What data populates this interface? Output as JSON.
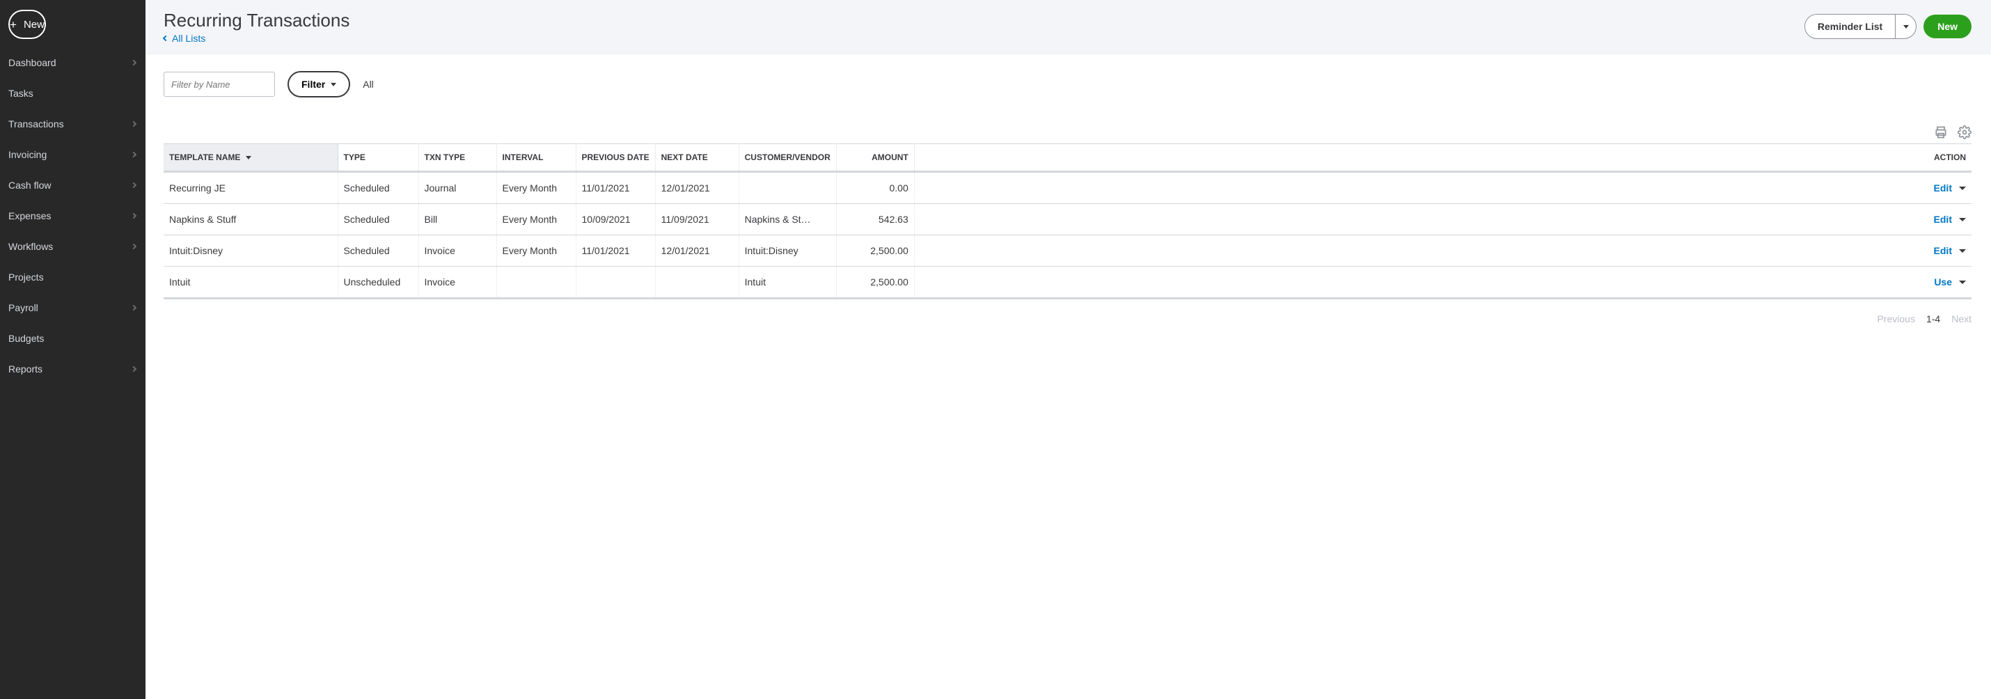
{
  "sidebar": {
    "new_label": "New",
    "items": [
      {
        "label": "Dashboard",
        "chevron": true
      },
      {
        "label": "Tasks",
        "chevron": false
      },
      {
        "label": "Transactions",
        "chevron": true
      },
      {
        "label": "Invoicing",
        "chevron": true
      },
      {
        "label": "Cash flow",
        "chevron": true
      },
      {
        "label": "Expenses",
        "chevron": true
      },
      {
        "label": "Workflows",
        "chevron": true
      },
      {
        "label": "Projects",
        "chevron": false
      },
      {
        "label": "Payroll",
        "chevron": true
      },
      {
        "label": "Budgets",
        "chevron": false
      },
      {
        "label": "Reports",
        "chevron": true
      }
    ]
  },
  "header": {
    "title": "Recurring Transactions",
    "back_link": "All Lists",
    "reminder_button": "Reminder List",
    "new_button": "New"
  },
  "toolbar": {
    "name_filter_placeholder": "Filter by Name",
    "filter_button": "Filter",
    "scope_label": "All"
  },
  "table": {
    "columns": {
      "name": "TEMPLATE NAME",
      "type": "TYPE",
      "txn": "TXN TYPE",
      "interval": "INTERVAL",
      "prev": "PREVIOUS DATE",
      "next": "NEXT DATE",
      "cust": "CUSTOMER/VENDOR",
      "amount": "AMOUNT",
      "action": "ACTION"
    },
    "rows": [
      {
        "name": "Recurring JE",
        "type": "Scheduled",
        "txn": "Journal",
        "interval": "Every Month",
        "prev": "11/01/2021",
        "next": "12/01/2021",
        "cust": "",
        "amount": "0.00",
        "action": "Edit"
      },
      {
        "name": "Napkins & Stuff",
        "type": "Scheduled",
        "txn": "Bill",
        "interval": "Every Month",
        "prev": "10/09/2021",
        "next": "11/09/2021",
        "cust": "Napkins & St…",
        "amount": "542.63",
        "action": "Edit"
      },
      {
        "name": "Intuit:Disney",
        "type": "Scheduled",
        "txn": "Invoice",
        "interval": "Every Month",
        "prev": "11/01/2021",
        "next": "12/01/2021",
        "cust": "Intuit:Disney",
        "amount": "2,500.00",
        "action": "Edit"
      },
      {
        "name": "Intuit",
        "type": "Unscheduled",
        "txn": "Invoice",
        "interval": "",
        "prev": "",
        "next": "",
        "cust": "Intuit",
        "amount": "2,500.00",
        "action": "Use"
      }
    ]
  },
  "pager": {
    "previous": "Previous",
    "range": "1-4",
    "next": "Next"
  }
}
